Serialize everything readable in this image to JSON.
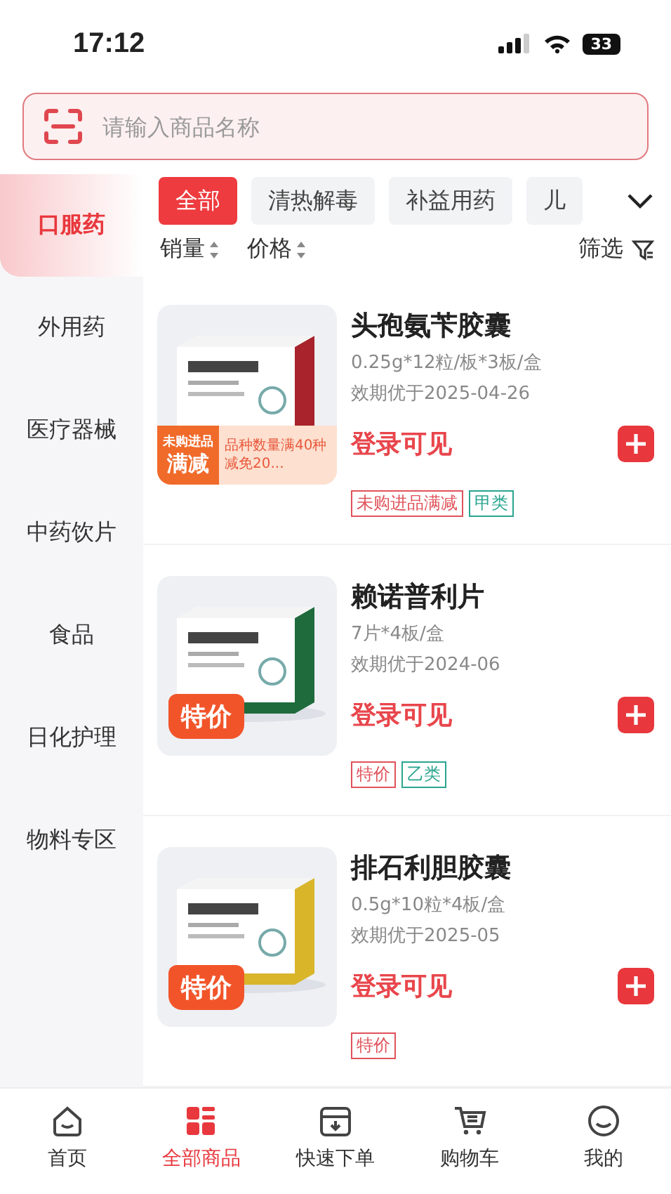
{
  "status_bar": {
    "time": "17:12",
    "battery": "33"
  },
  "search": {
    "placeholder": "请输入商品名称"
  },
  "sidebar": {
    "items": [
      {
        "label": "口服药",
        "selected": true
      },
      {
        "label": "外用药",
        "selected": false
      },
      {
        "label": "医疗器械",
        "selected": false
      },
      {
        "label": "中药饮片",
        "selected": false
      },
      {
        "label": "食品",
        "selected": false
      },
      {
        "label": "日化护理",
        "selected": false
      },
      {
        "label": "物料专区",
        "selected": false
      }
    ]
  },
  "chips": [
    {
      "label": "全部",
      "selected": true
    },
    {
      "label": "清热解毒",
      "selected": false
    },
    {
      "label": "补益用药",
      "selected": false
    },
    {
      "label": "儿",
      "selected": false
    }
  ],
  "sort": [
    {
      "label": "销量"
    },
    {
      "label": "价格"
    }
  ],
  "filter": {
    "label": "筛选"
  },
  "products": [
    {
      "name": "头孢氨苄胶囊",
      "spec": "0.25g*12粒/板*3板/盒",
      "expiry": "效期优于2025-04-26",
      "price": "登录可见",
      "badge": {
        "kind": "promo",
        "label": "未购进品",
        "title": "满减",
        "text": "品种数量满40种减免20..."
      },
      "tags": [
        {
          "label": "未购进品满减",
          "color": "#e0525a"
        },
        {
          "label": "甲类",
          "color": "#2aa58f"
        }
      ]
    },
    {
      "name": "赖诺普利片",
      "spec": "7片*4板/盒",
      "expiry": "效期优于2024-06",
      "price": "登录可见",
      "badge": {
        "kind": "special",
        "title": "特价"
      },
      "tags": [
        {
          "label": "特价",
          "color": "#e0525a"
        },
        {
          "label": "乙类",
          "color": "#2aa58f"
        }
      ]
    },
    {
      "name": "排石利胆胶囊",
      "spec": "0.5g*10粒*4板/盒",
      "expiry": "效期优于2025-05",
      "price": "登录可见",
      "badge": {
        "kind": "special",
        "title": "特价"
      },
      "tags": [
        {
          "label": "特价",
          "color": "#e0525a"
        }
      ]
    }
  ],
  "tab_bar": [
    {
      "label": "首页",
      "kind": "home",
      "selected": false
    },
    {
      "label": "全部商品",
      "kind": "grid",
      "selected": true
    },
    {
      "label": "快速下单",
      "kind": "box",
      "selected": false
    },
    {
      "label": "购物车",
      "kind": "cart",
      "selected": false
    },
    {
      "label": "我的",
      "kind": "face",
      "selected": false
    }
  ]
}
